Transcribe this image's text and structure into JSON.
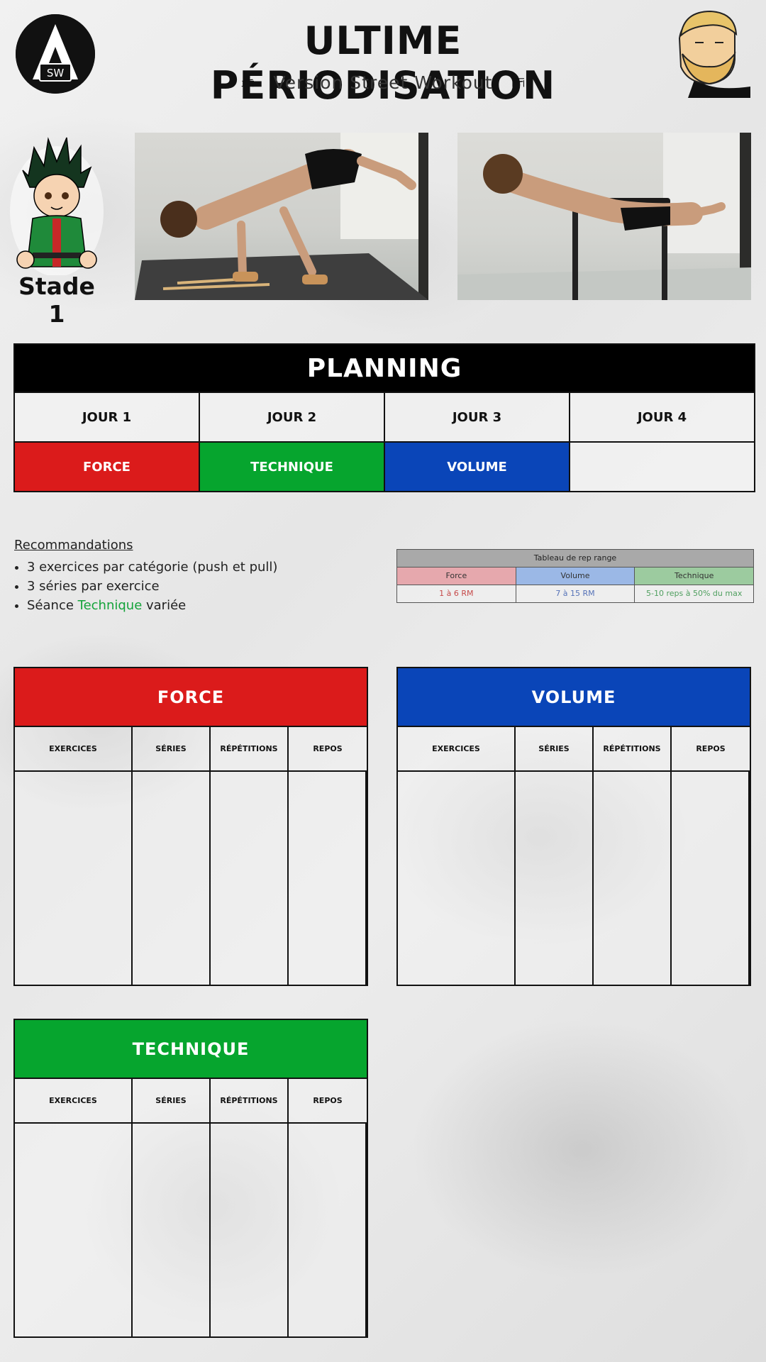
{
  "header": {
    "title": "ULTIME PÉRIODISATION",
    "subtitle": "Version Street Workout",
    "logo_text": "SW"
  },
  "hero": {
    "stage_label": "Stade 1"
  },
  "planning": {
    "title": "PLANNING",
    "days": [
      "JOUR 1",
      "JOUR 2",
      "JOUR 3",
      "JOUR 4"
    ],
    "sessions": [
      "FORCE",
      "TECHNIQUE",
      "VOLUME",
      ""
    ]
  },
  "recommendations": {
    "title": "Recommandations",
    "items": [
      "3 exercices par catégorie (push et pull)",
      "3 séries par exercice"
    ],
    "item3_prefix": "Séance ",
    "item3_highlight": "Technique",
    "item3_suffix": " variée"
  },
  "rep_range": {
    "title": "Tableau de rep range",
    "headers": [
      "Force",
      "Volume",
      "Technique"
    ],
    "values": [
      "1 à 6 RM",
      "7 à 15 RM",
      "5-10 reps à 50% du max"
    ]
  },
  "workout_columns": [
    "EXERCICES",
    "SÉRIES",
    "RÉPÉTITIONS",
    "REPOS"
  ],
  "workouts": {
    "force": "FORCE",
    "volume": "VOLUME",
    "technique": "TECHNIQUE"
  },
  "colors": {
    "force": "#db1b1b",
    "technique": "#06a52e",
    "volume": "#0a45b8",
    "planning_header": "#000000"
  }
}
